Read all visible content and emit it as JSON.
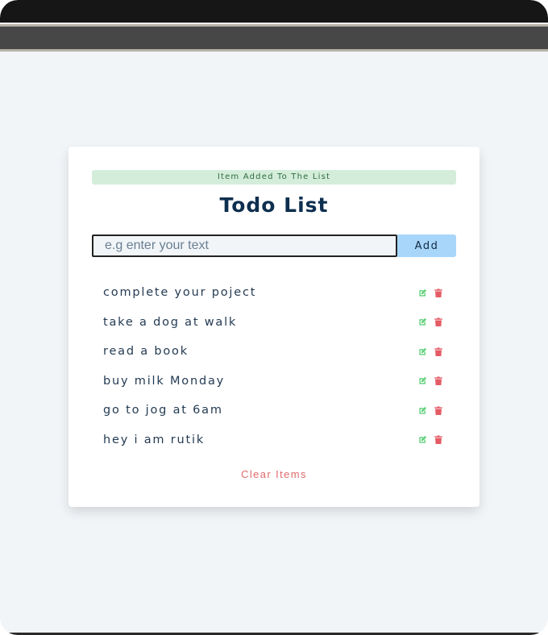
{
  "alert": {
    "text": "Item Added To The List"
  },
  "app": {
    "title": "Todo List"
  },
  "form": {
    "placeholder": "e.g enter your text",
    "value": "",
    "add_label": "Add"
  },
  "items": [
    {
      "text": "complete your poject"
    },
    {
      "text": "take a dog at walk"
    },
    {
      "text": "read a book"
    },
    {
      "text": "buy milk Monday"
    },
    {
      "text": "go to jog at 6am"
    },
    {
      "text": "hey i am rutik"
    }
  ],
  "item_icons": {
    "edit": "edit-icon",
    "delete": "trash-icon"
  },
  "clear": {
    "label": "Clear Items"
  },
  "colors": {
    "accent": "#a8d6fa",
    "title": "#0e2f4f",
    "alert_bg": "#d4eddb",
    "alert_text": "#2f6b3d",
    "edit": "#5fd07a",
    "delete": "#e45b66",
    "clear": "#e06a6a"
  }
}
